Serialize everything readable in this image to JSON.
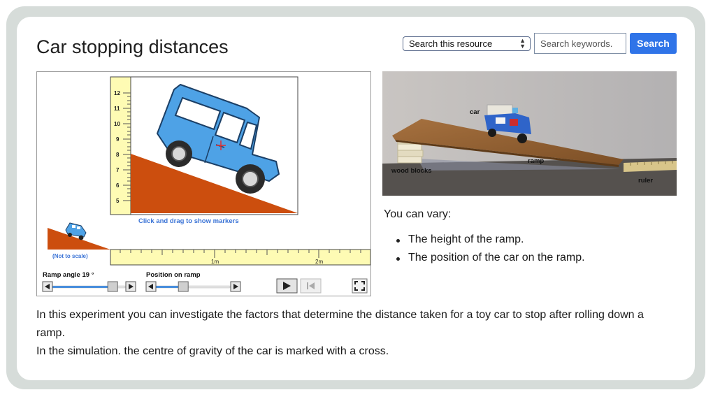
{
  "page": {
    "title": "Car stopping distances"
  },
  "search": {
    "scope_value": "Search this resource",
    "placeholder": "Search keywords.",
    "button_label": "Search"
  },
  "simulation": {
    "ruler_vertical_ticks": [
      "12",
      "11",
      "10",
      "9",
      "8",
      "7",
      "6",
      "5"
    ],
    "hint": "Click and drag to show markers",
    "not_to_scale": "(Not to scale)",
    "ruler_horizontal_labels": [
      "1m",
      "2m"
    ],
    "ramp_angle_label": "Ramp angle 19 °",
    "position_label": "Position on ramp",
    "ramp_angle_slider_value": 0.88,
    "position_slider_value": 0.35
  },
  "photo": {
    "labels": {
      "car": "car",
      "ramp": "ramp",
      "wood_blocks": "wood blocks",
      "ruler": "ruler"
    }
  },
  "vary": {
    "heading": "You can vary:",
    "items": [
      "The height of the ramp.",
      "The position of the car on the ramp."
    ]
  },
  "intro": {
    "paragraph1": "In this experiment you can investigate the factors that determine the distance taken for a toy car to stop after rolling down a ramp.",
    "paragraph2": "In the simulation. the centre of gravity of the car is marked with a cross."
  },
  "colors": {
    "ramp": "#cc4e0e",
    "car": "#4ea2e6",
    "ruler": "#fefbb4",
    "search_button": "#2f74e8",
    "hint_text": "#3a73d6"
  }
}
